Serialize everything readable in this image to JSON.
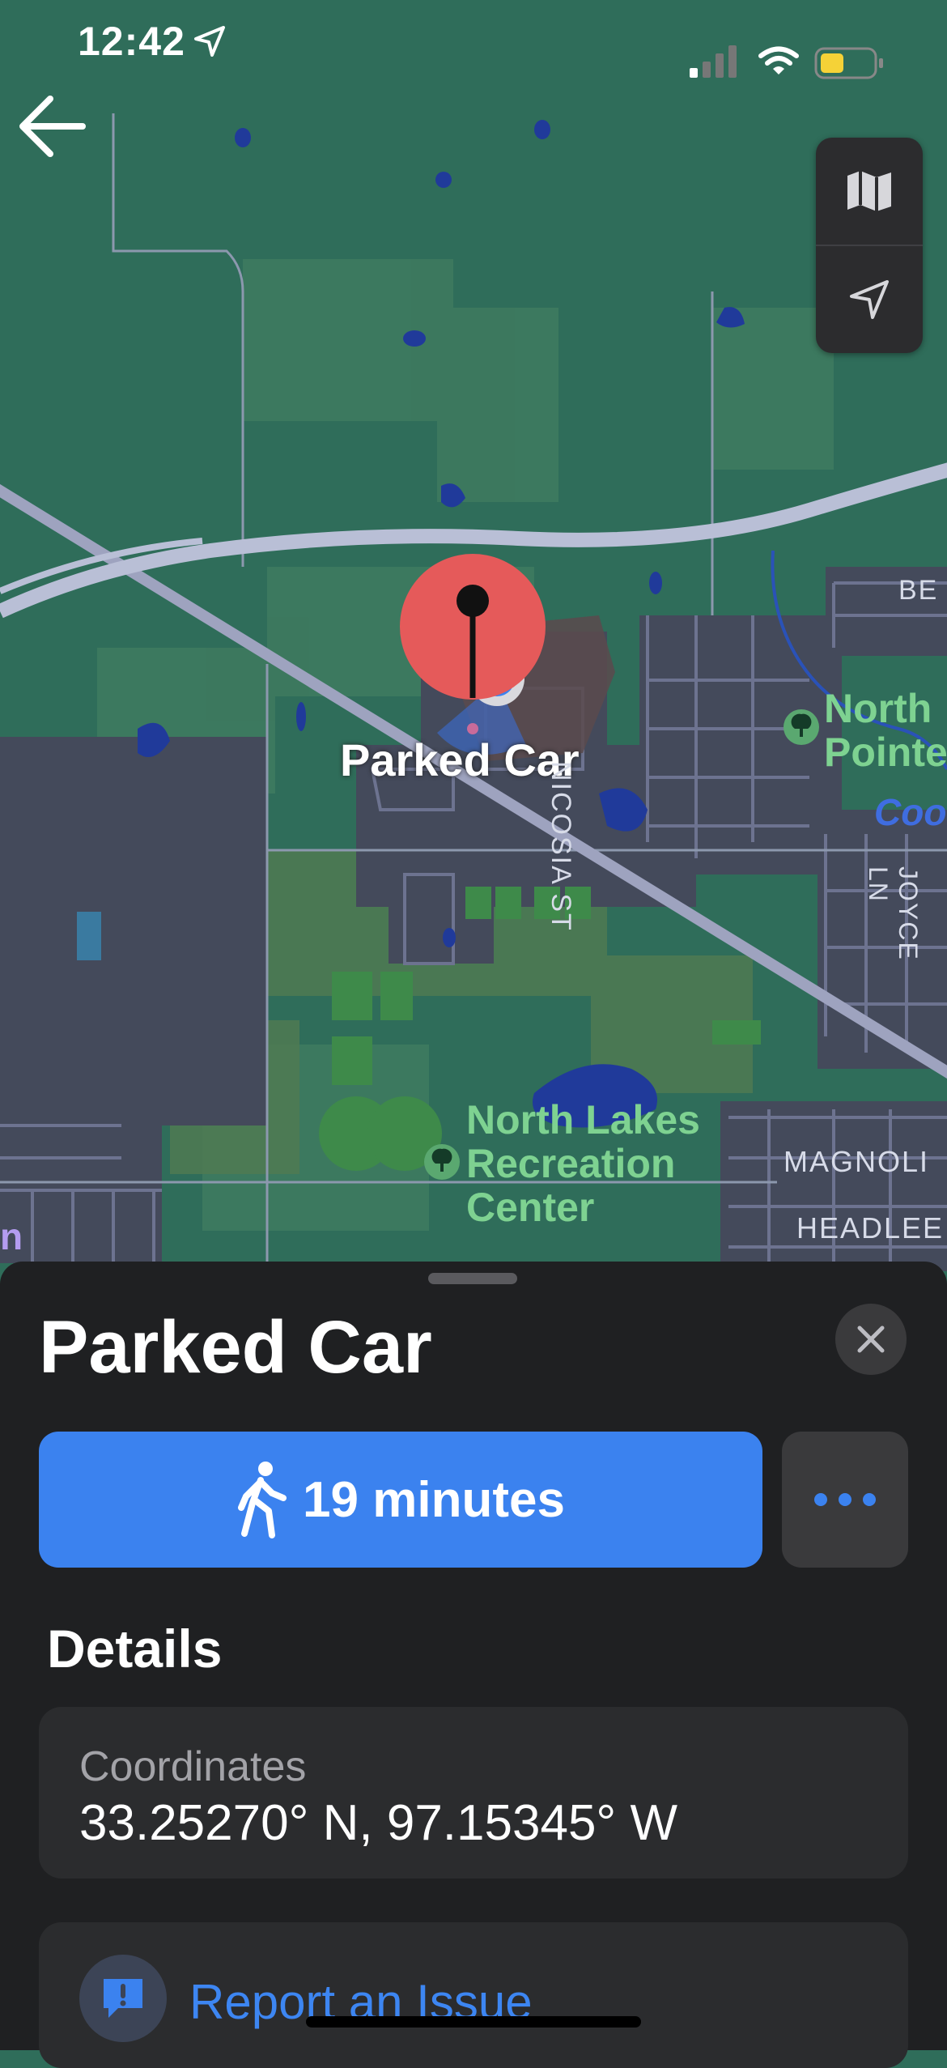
{
  "status_bar": {
    "time": "12:42"
  },
  "map": {
    "pin_label": "Parked Car",
    "labels": {
      "nicosia": "NICOSIA ST",
      "joyce": "JOYCE LN",
      "be": "BE",
      "magnolia": "MAGNOLI",
      "headlee": "HEADLEE",
      "north_pointe_1": "North",
      "north_pointe_2": "Pointe",
      "creek": "Coo",
      "rec_1": "North Lakes",
      "rec_2": "Recreation",
      "rec_3": "Center",
      "edge_letter": "n"
    }
  },
  "sheet": {
    "title": "Parked Car",
    "route_label": "19 minutes",
    "details_heading": "Details",
    "coordinates_label": "Coordinates",
    "coordinates_value": "33.25270° N, 97.15345° W",
    "report_label": "Report an Issue"
  },
  "colors": {
    "map_green": "#2f6d5a",
    "urban_gray": "#444a5b",
    "water": "#203a9a",
    "road": "#b9bfd6",
    "pin_red": "#e55a5a",
    "accent_blue": "#3b82ef",
    "sheet_bg": "#1f2022"
  },
  "icons": [
    "back-arrow-icon",
    "map-icon",
    "location-arrow-icon",
    "close-icon",
    "walk-icon",
    "more-icon",
    "report-icon",
    "signal-icon",
    "wifi-icon",
    "battery-icon"
  ]
}
